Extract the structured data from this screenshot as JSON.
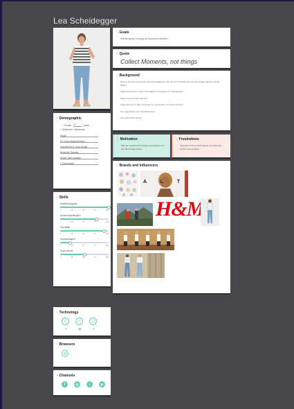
{
  "persona": {
    "name": "Lea Scheidegger"
  },
  "demographic": {
    "title": "Demographic",
    "gender": "Female",
    "age": "27",
    "age_unit": "years",
    "location": "Dübendorf, Ostschweiz",
    "fields": [
      "Single",
      "Kv. Lehre abgeschlossen",
      "Tanzlehrerin in Tanz-Schule",
      "Reisende Traveller",
      "Wohnt mich zuhause",
      "1 Geschwister"
    ]
  },
  "skills": {
    "title": "Skills",
    "ticks": [
      "0",
      "25",
      "50",
      "75",
      "100"
    ],
    "items": [
      {
        "label": "Auffassungsgabe",
        "value": 100
      },
      {
        "label": "Umsetzungsfähigkeit",
        "value": 75
      },
      {
        "label": "Flexibilität",
        "value": 90
      },
      {
        "label": "Selbständigkeit",
        "value": 20
      },
      {
        "label": "Social Media",
        "value": 50
      }
    ]
  },
  "technology": {
    "title": "Technology",
    "devices": [
      "mobile-icon",
      "tablet-icon",
      "desktop-icon"
    ],
    "os": [
      "apple-icon",
      "android-icon",
      "apple-icon"
    ]
  },
  "browsers": {
    "title": "Browsers"
  },
  "channels": {
    "title": "Channels",
    "items": [
      "f",
      "◎",
      "t",
      "▶"
    ]
  },
  "goals": {
    "title": "Goals",
    "body": "Will Ihre ganze Leistung auf das Arbeit erreichen."
  },
  "quote": {
    "title": "Quote",
    "body": "Collect Moments, not things"
  },
  "background": {
    "title": "Background",
    "paragraphs": [
      "Hat am Wochenende keine Zeit für Sozialarbeit. Sie nimmt an Tanzkursen teil und stehen danach auf die Bühne.",
      "Macht Unterricht in Tanz und Auftritte im Ausland von Tanzgruppen.",
      "Steht sich um 6 Uhr früh auf.",
      "Pflegt alles für 2 Jahre Freunde um mit Kunden zu kommunizieren.",
      "Sie mag Kinder und unterrichtet gern.",
      "Sie mag keinen Stress"
    ]
  },
  "motivation": {
    "title": "Motivation",
    "body": "Will den Kunden Schnell die Informationen zu der Tanzschule geben."
  },
  "frustrations": {
    "title": "Frustrations",
    "body": "Aktuelles Infos ist nicht aktuell, die Webseite wurde nicht gepflegt."
  },
  "brands": {
    "title": "Brands and Influencers",
    "hm": "H&M",
    "alt_letters": "A L T"
  },
  "colors": {
    "accent": "#63cdb4",
    "frustration": "#e15b4a",
    "background": "#45474d"
  }
}
